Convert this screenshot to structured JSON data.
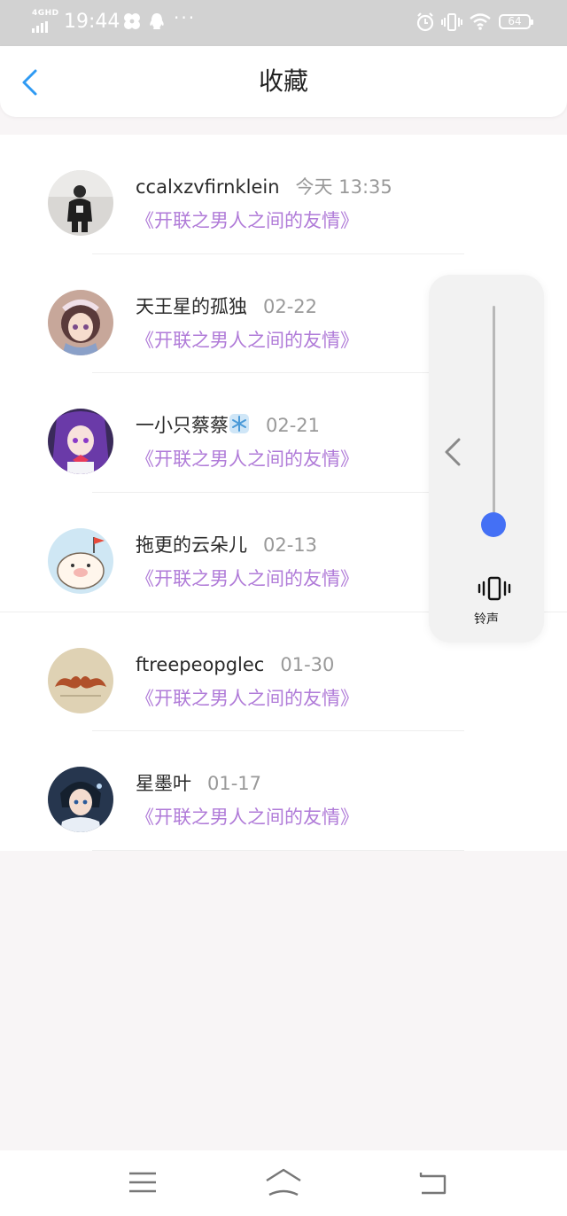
{
  "status_bar": {
    "network": "4GHD",
    "time": "19:44",
    "battery": "64",
    "more": "···"
  },
  "header": {
    "title": "收藏"
  },
  "items": [
    {
      "name": "ccalxzvfirnklein",
      "date": "今天 13:35",
      "title": "《开联之男人之间的友情》"
    },
    {
      "name": "天王星的孤独",
      "date": "02-22",
      "title": "《开联之男人之间的友情》"
    },
    {
      "name": "一小只蔡蔡",
      "date": "02-21",
      "title": "《开联之男人之间的友情》"
    },
    {
      "name": "拖更的云朵儿",
      "date": "02-13",
      "title": "《开联之男人之间的友情》"
    },
    {
      "name": "ftreepeopglec",
      "date": "01-30",
      "title": "《开联之男人之间的友情》"
    },
    {
      "name": "星墨叶",
      "date": "01-17",
      "title": "《开联之男人之间的友情》"
    }
  ],
  "volume": {
    "label": "铃声",
    "level": 0.05,
    "accent": "#4470f5"
  },
  "colors": {
    "title_purple": "#b07bd8",
    "back_blue": "#2f9af3"
  }
}
